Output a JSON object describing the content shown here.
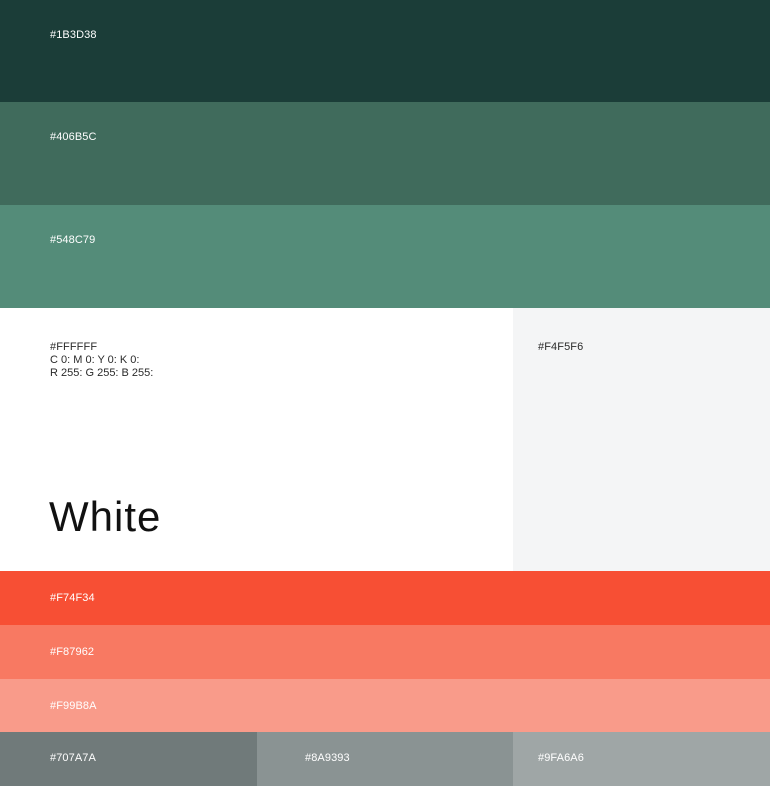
{
  "swatches": {
    "green_dark": {
      "hex": "#1B3D38"
    },
    "green_mid": {
      "hex": "#406B5C"
    },
    "green_light": {
      "hex": "#548C79"
    },
    "white": {
      "hex": "#FFFFFF",
      "cmyk": "C 0: M 0: Y 0: K 0:",
      "rgb": "R 255: G 255: B 255:",
      "name": "White"
    },
    "gray_bg": {
      "hex": "#F4F5F6"
    },
    "orange": {
      "hex": "#F74F34"
    },
    "orange_mid": {
      "hex": "#F87962"
    },
    "orange_light": {
      "hex": "#F99B8A"
    },
    "gray_1": {
      "hex": "#707A7A"
    },
    "gray_2": {
      "hex": "#8A9393"
    },
    "gray_3": {
      "hex": "#9FA6A6"
    }
  },
  "colors": {
    "green_dark": "#1B3D38",
    "green_mid": "#406B5C",
    "green_light": "#548C79",
    "white": "#FFFFFF",
    "gray_bg": "#F4F5F6",
    "orange": "#F74F34",
    "orange_mid": "#F87962",
    "orange_light": "#F99B8A",
    "gray_1": "#707A7A",
    "gray_2": "#8A9393",
    "gray_3": "#9FA6A6"
  }
}
